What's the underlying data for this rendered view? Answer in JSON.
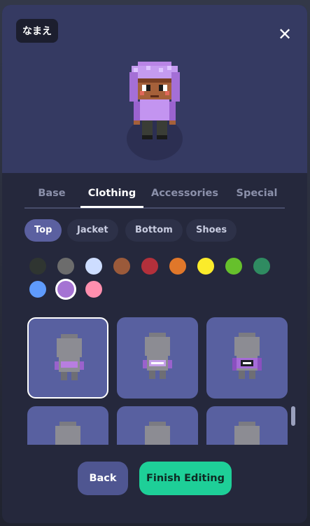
{
  "header": {
    "name_label": "なまえ",
    "close_icon": "close-icon"
  },
  "tabs": [
    {
      "label": "Base",
      "active": false
    },
    {
      "label": "Clothing",
      "active": true
    },
    {
      "label": "Accessories",
      "active": false
    },
    {
      "label": "Special",
      "active": false
    }
  ],
  "subtabs": [
    {
      "label": "Top",
      "active": true
    },
    {
      "label": "Jacket",
      "active": false
    },
    {
      "label": "Bottom",
      "active": false
    },
    {
      "label": "Shoes",
      "active": false
    }
  ],
  "colors": [
    "#2f3531",
    "#6c6c6c",
    "#cdddff",
    "#9b5a3a",
    "#b3303b",
    "#e0772a",
    "#fbeb2b",
    "#66c02c",
    "#2f8b61",
    "#5f9bfd",
    "#a573d3",
    "#ff8fae"
  ],
  "selected_color_index": 10,
  "items": [
    {
      "style": "top-1",
      "selected": true
    },
    {
      "style": "top-2",
      "selected": false
    },
    {
      "style": "top-3",
      "selected": false
    },
    {
      "style": "top-4",
      "selected": false
    },
    {
      "style": "top-5",
      "selected": false
    },
    {
      "style": "top-6",
      "selected": false
    }
  ],
  "buttons": {
    "back_label": "Back",
    "finish_label": "Finish Editing"
  }
}
